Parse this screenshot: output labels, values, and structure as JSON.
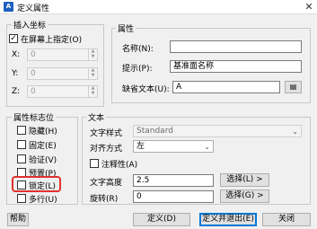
{
  "window": {
    "title": "定义属性",
    "app_icon": "A",
    "close_glyph": "✕"
  },
  "insertion": {
    "group_label": "插入坐标",
    "on_screen_label": "在屏幕上指定(O)",
    "on_screen_checked": true,
    "x_label": "X:",
    "x_value": "0",
    "y_label": "Y:",
    "y_value": "0",
    "z_label": "Z:",
    "z_value": "0"
  },
  "attribute": {
    "group_label": "属性",
    "name_label": "名称(N):",
    "name_value": "",
    "prompt_label": "提示(P):",
    "prompt_value": "基准面名称",
    "default_label": "缺省文本(U):",
    "default_value": "A"
  },
  "flags": {
    "group_label": "属性标志位",
    "items": [
      {
        "label": "隐藏(H)",
        "checked": false
      },
      {
        "label": "固定(E)",
        "checked": false
      },
      {
        "label": "验证(V)",
        "checked": false
      },
      {
        "label": "预置(P)",
        "checked": false
      },
      {
        "label": "锁定(L)",
        "checked": false
      },
      {
        "label": "多行(U)",
        "checked": false
      }
    ]
  },
  "text": {
    "group_label": "文本",
    "style_label": "文字样式",
    "style_value": "Standard",
    "justify_label": "对齐方式",
    "justify_value": "左",
    "annotative_label": "注释性(A)",
    "annotative_checked": false,
    "height_label": "文字高度",
    "height_value": "2.5",
    "rotation_label": "旋转(R)",
    "rotation_value": "0",
    "select_height_label": "选择(L) >",
    "select_rotation_label": "选择(G) >"
  },
  "buttons": {
    "help": "帮助",
    "ok": "定义(D)",
    "ok_exit": "定义并退出(E)",
    "close": "关闭"
  },
  "colors": {
    "highlight": "#e0312b",
    "accent": "#0078d7"
  }
}
